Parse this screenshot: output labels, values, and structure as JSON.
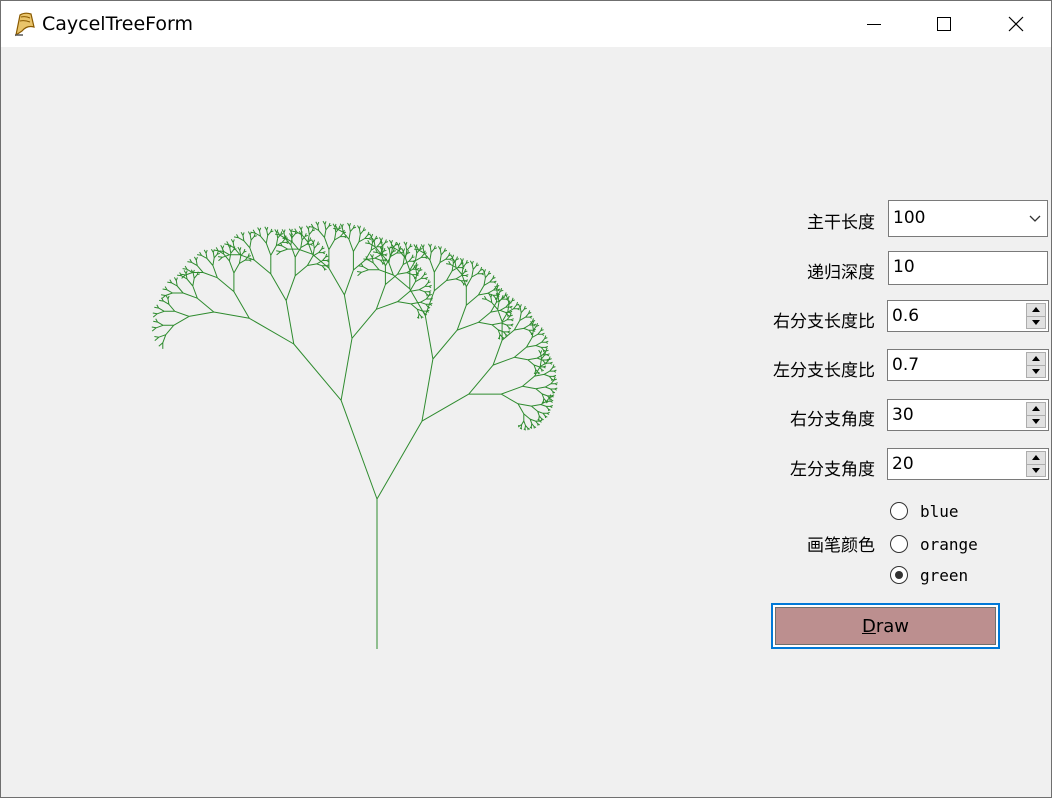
{
  "window": {
    "title": "CaycelTreeForm"
  },
  "form": {
    "trunk_length": {
      "label": "主干长度",
      "value": "100"
    },
    "recursion_depth": {
      "label": "递归深度",
      "value": "10"
    },
    "right_ratio": {
      "label": "右分支长度比",
      "value": "0.6"
    },
    "left_ratio": {
      "label": "左分支长度比",
      "value": "0.7"
    },
    "right_angle": {
      "label": "右分支角度",
      "value": "30"
    },
    "left_angle": {
      "label": "左分支角度",
      "value": "20"
    },
    "pen_color": {
      "label": "画笔颜色",
      "options": [
        "blue",
        "orange",
        "green"
      ],
      "selected": "green"
    },
    "draw_button": {
      "mnemonic": "D",
      "rest": "raw"
    }
  },
  "tree": {
    "color": "#2e8b2e"
  },
  "colors": {
    "draw_button_bg": "#bc8f8f",
    "focus_border": "#0078d7"
  }
}
